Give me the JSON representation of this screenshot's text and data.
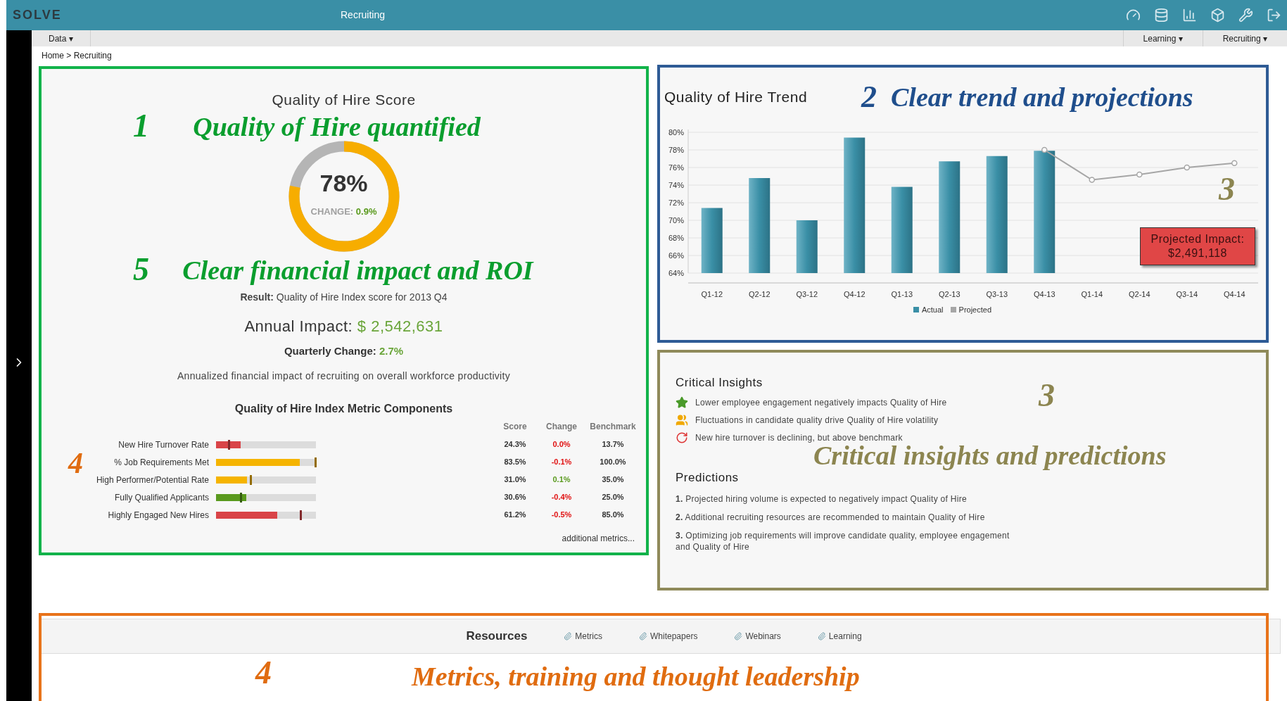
{
  "header": {
    "logo": "SOLVE",
    "title": "Recruiting"
  },
  "menu": {
    "left": [
      {
        "label": "Data ▾"
      }
    ],
    "right": [
      {
        "label": "Learning ▾"
      },
      {
        "label": "Recruiting ▾"
      }
    ]
  },
  "breadcrumb": "Home > Recruiting",
  "score_panel": {
    "title": "Quality of Hire Score",
    "callouts": [
      {
        "number": "1",
        "text": "Quality of Hire quantified",
        "color": "#0a9e2e"
      },
      {
        "number": "5",
        "text": "Clear financial impact and ROI",
        "color": "#0a9e2e"
      }
    ],
    "gauge": {
      "value": "78%",
      "change_label": "CHANGE:",
      "change": "0.9%",
      "level": 0.78
    },
    "result": "**Result:** Quality of Hire Index score for 2013 Q4",
    "annual_impact": {
      "label": "Annual Impact:",
      "value": "$ 2,542,631"
    },
    "quarterly_change": {
      "label": "Quarterly Change:",
      "value": "2.7%"
    },
    "description": "Annualized financial impact of recruiting on overall workforce productivity",
    "metrics": {
      "title": "Quality of Hire Index Metric Components",
      "columns": [
        "Score",
        "Change",
        "Benchmark"
      ],
      "callout": {
        "number": "4",
        "color": "#e06c10"
      },
      "rows": [
        {
          "label": "New Hire Turnover Rate",
          "score": "24.3%",
          "change": {
            "text": "0.0%",
            "color": "#e01010"
          },
          "benchmark": "13.7%",
          "level": 0.243,
          "color": "#d94448"
        },
        {
          "label": "% Job Requirements Met",
          "score": "83.5%",
          "change": {
            "text": "-0.1%",
            "color": "#e01010"
          },
          "benchmark": "100.0%",
          "level": 0.835,
          "color": "#f5b400"
        },
        {
          "label": "High Performer/Potential Rate",
          "score": "31.0%",
          "change": {
            "text": "0.1%",
            "color": "#5a9a1e"
          },
          "benchmark": "35.0%",
          "level": 0.31,
          "color": "#f5b400"
        },
        {
          "label": "Fully Qualified Applicants",
          "score": "30.6%",
          "change": {
            "text": "-0.4%",
            "color": "#e01010"
          },
          "benchmark": "25.0%",
          "level": 0.306,
          "color": "#5a9a1e"
        },
        {
          "label": "Highly Engaged New Hires",
          "score": "61.2%",
          "change": {
            "text": "-0.5%",
            "color": "#e01010"
          },
          "benchmark": "85.0%",
          "level": 0.612,
          "color": "#d94448"
        }
      ],
      "more_link": "additional metrics..."
    }
  },
  "trend_panel": {
    "title": "Quality of Hire Trend",
    "callout": {
      "number": "2",
      "text": "Clear trend and projections",
      "color": "#1f4e8c"
    },
    "side_callout": {
      "number": "3",
      "color": "#8c8550"
    },
    "chart_data": {
      "type": "bar",
      "stacked": false,
      "grid": true,
      "categories": [
        "Q1-12",
        "Q2-12",
        "Q3-12",
        "Q4-12",
        "Q1-13",
        "Q2-13",
        "Q3-13",
        "Q4-13",
        "Q1-14",
        "Q2-14",
        "Q3-14",
        "Q4-14"
      ],
      "series": [
        {
          "name": "Actual",
          "type": "bar",
          "color": "#3a8fa6",
          "values": [
            71.4,
            74.8,
            70.0,
            79.4,
            73.8,
            76.7,
            77.3,
            77.9,
            null,
            null,
            null,
            null
          ]
        },
        {
          "name": "Projected",
          "type": "line",
          "marker": "circle",
          "color": "#a6a6a6",
          "values": [
            null,
            null,
            null,
            null,
            null,
            null,
            null,
            78.0,
            74.6,
            75.2,
            76.0,
            76.5
          ]
        }
      ],
      "ylim": [
        64,
        80
      ],
      "yticks": [
        {
          "value": 64,
          "label": "64%"
        },
        {
          "value": 66,
          "label": "66%"
        },
        {
          "value": 68,
          "label": "68%"
        },
        {
          "value": 70,
          "label": "70%"
        },
        {
          "value": 72,
          "label": "72%"
        },
        {
          "value": 74,
          "label": "74%"
        },
        {
          "value": 76,
          "label": "76%"
        },
        {
          "value": 78,
          "label": "78%"
        },
        {
          "value": 80,
          "label": "80%"
        }
      ]
    },
    "projected_impact": {
      "label": "Projected Impact:",
      "value": "$2,491,118"
    }
  },
  "insights_panel": {
    "title": "Critical Insights",
    "insights": [
      {
        "kind": "star",
        "text": "Lower employee engagement negatively impacts Quality of Hire"
      },
      {
        "kind": "people",
        "text": "Fluctuations in candidate quality drive Quality of Hire volatility"
      },
      {
        "kind": "refresh",
        "text": "New hire turnover is declining, but above benchmark"
      }
    ],
    "predictions_title": "Predictions",
    "predictions": [
      "**1.** Projected hiring volume is expected to negatively impact Quality of Hire",
      "**2.** Additional recruiting resources are recommended to maintain Quality of Hire",
      "**3.** Optimizing job requirements will improve candidate quality, employee engagement and Quality of Hire"
    ],
    "callout": {
      "number": "3",
      "text": "Critical insights and predictions",
      "color": "#8c8550"
    }
  },
  "resources": {
    "title": "Resources",
    "links": [
      "Metrics",
      "Whitepapers",
      "Webinars",
      "Learning"
    ],
    "callout": {
      "number": "4",
      "text": "Metrics, training and thought leadership",
      "color": "#e06c10"
    }
  }
}
